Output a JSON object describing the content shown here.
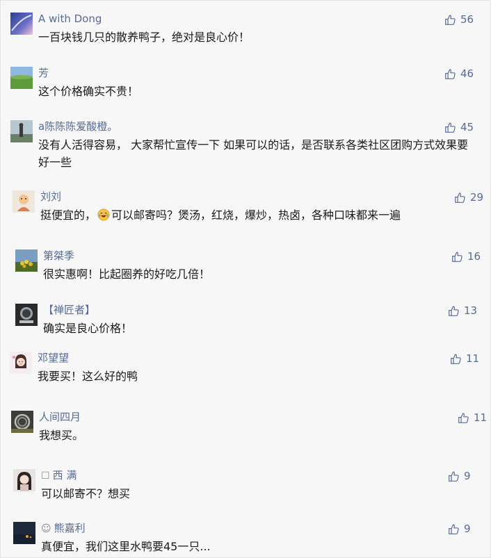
{
  "comments": [
    {
      "name": "A with Dong",
      "text": "一百块钱几只的散养鸭子，绝对是良心价！",
      "likes": "56"
    },
    {
      "name": "芳",
      "text": "这个价格确实不贵！",
      "likes": "46"
    },
    {
      "name": "a陈陈陈爱酸橙。",
      "text": "没有人活得容易， 大家帮忙宣传一下  如果可以的话，是否联系各类社区团购方式效果要好一些",
      "likes": "45"
    },
    {
      "name": "刘刘",
      "text_before": "挺便宜的，",
      "emoji": "laugh-cry-emoji",
      "text_after": "可以邮寄吗？煲汤，红烧，爆炒，热卤，各种口味都来一遍",
      "likes": "29"
    },
    {
      "name": "第桀季",
      "text": "很实惠啊！比起圈养的好吃几倍！",
      "likes": "16"
    },
    {
      "name": "【禅匠者】",
      "text": "确实是良心价格！",
      "likes": "13"
    },
    {
      "name": "邓望望",
      "text": "我要买！这么好的鸭",
      "likes": "11"
    },
    {
      "name": "人间四月",
      "text": "我想买。",
      "likes": "11"
    },
    {
      "name": "西 满",
      "name_icon": "square-icon",
      "text": "可以邮寄不？想买",
      "likes": "9"
    },
    {
      "name": "熊嘉利",
      "name_icon": "smile-icon",
      "text": "真便宜，我们这里水鸭要45一只...",
      "likes": "9"
    }
  ],
  "colors": {
    "name": "#576b95",
    "text": "#1a1a1a",
    "background": "#f7f7f7"
  }
}
